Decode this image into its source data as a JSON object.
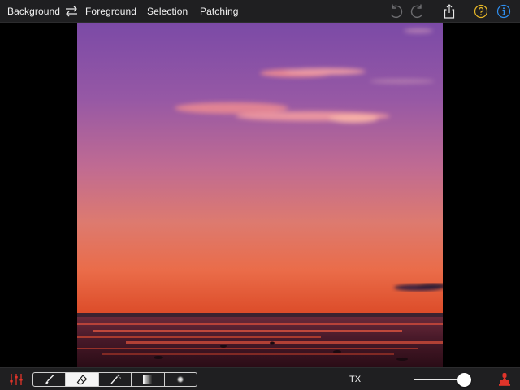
{
  "topbar": {
    "nav": {
      "background_label": "Background",
      "foreground_label": "Foreground",
      "selection_label": "Selection",
      "patching_label": "Patching"
    },
    "icons": {
      "swap": "swap-arrows-icon",
      "undo": "undo-icon",
      "redo": "redo-icon",
      "share": "share-icon",
      "help": "help-icon",
      "info": "info-icon"
    }
  },
  "canvas": {
    "image_subject": "sunset sky over water"
  },
  "bottombar": {
    "tools": [
      {
        "icon": "brush-icon",
        "active": false
      },
      {
        "icon": "eraser-icon",
        "active": true
      },
      {
        "icon": "magic-wand-icon",
        "active": false
      },
      {
        "icon": "gradient-icon",
        "active": false
      },
      {
        "icon": "soft-brush-icon",
        "active": false
      }
    ],
    "tx_label": "TX",
    "brush_size_fraction": 0.85,
    "icons": {
      "adjust": "adjustments-icon",
      "stamp": "stamp-icon"
    }
  },
  "colors": {
    "toolbar_bg": "#1f1f21",
    "accent_red": "#e0342a",
    "help_yellow": "#e7b727",
    "info_blue": "#2f8ff0",
    "icon_gray": "#8a8a8c"
  }
}
